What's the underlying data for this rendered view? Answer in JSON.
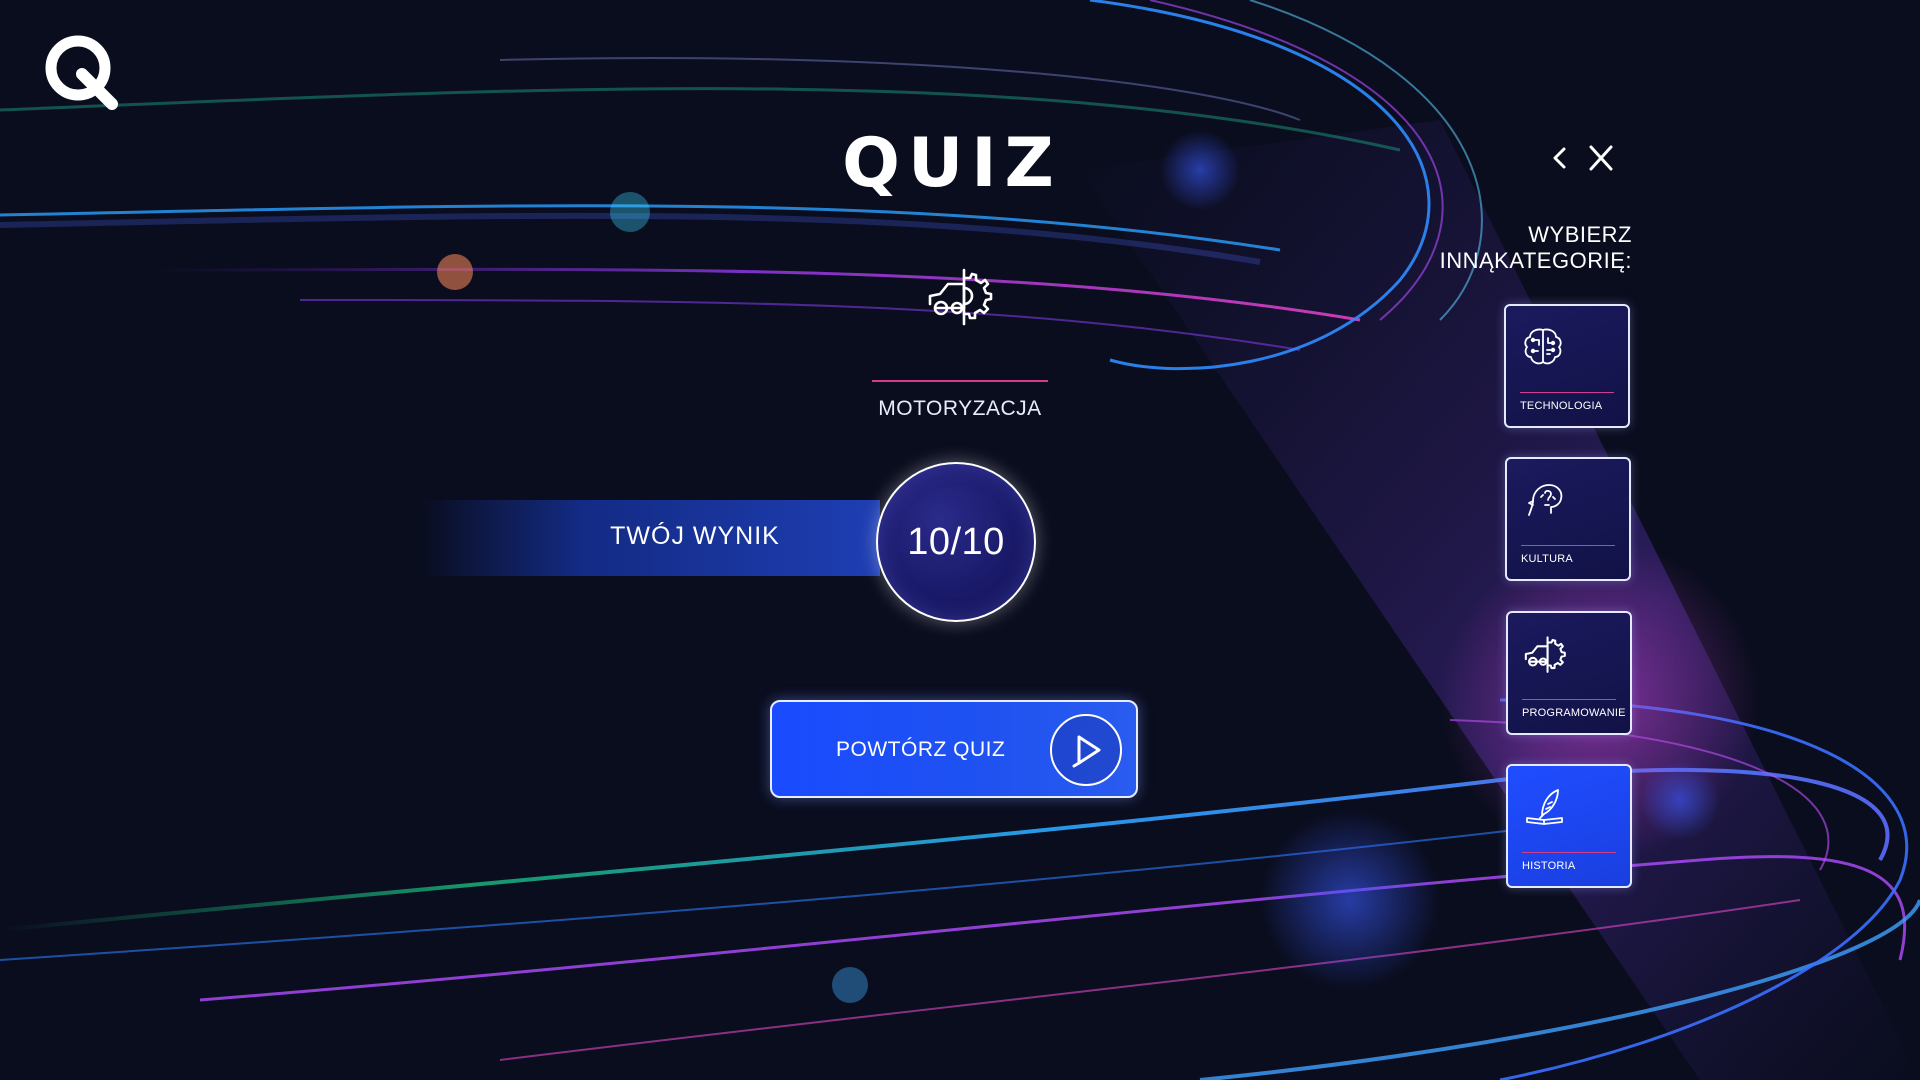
{
  "app": {
    "title": "QUIZ",
    "logo_icon": "q-logo-icon"
  },
  "quiz": {
    "category_icon": "car-gear-icon",
    "category_name": "MOTORYZACJA",
    "score_label": "TWÓJ WYNIK",
    "score_value": "10/10",
    "repeat_label": "POWTÓRZ QUIZ",
    "repeat_icon": "play-icon"
  },
  "controls": {
    "back_icon": "chevron-left-icon",
    "close_icon": "close-icon"
  },
  "sidebar": {
    "heading_line1": "WYBIERZ",
    "heading_line2": "INNĄKATEGORIĘ:",
    "categories": [
      {
        "label": "TECHNOLOGIA",
        "icon": "brain-circuit-icon",
        "active": false
      },
      {
        "label": "KULTURA",
        "icon": "head-thinking-icon",
        "active": false
      },
      {
        "label": "PROGRAMOWANIE",
        "icon": "car-gear-icon",
        "active": false
      },
      {
        "label": "HISTORIA",
        "icon": "quill-book-icon",
        "active": true
      }
    ]
  },
  "colors": {
    "background": "#0a0d1e",
    "accent_blue": "#1f4dff",
    "accent_pink": "#d33c8c",
    "tile_dark": "#161652"
  }
}
